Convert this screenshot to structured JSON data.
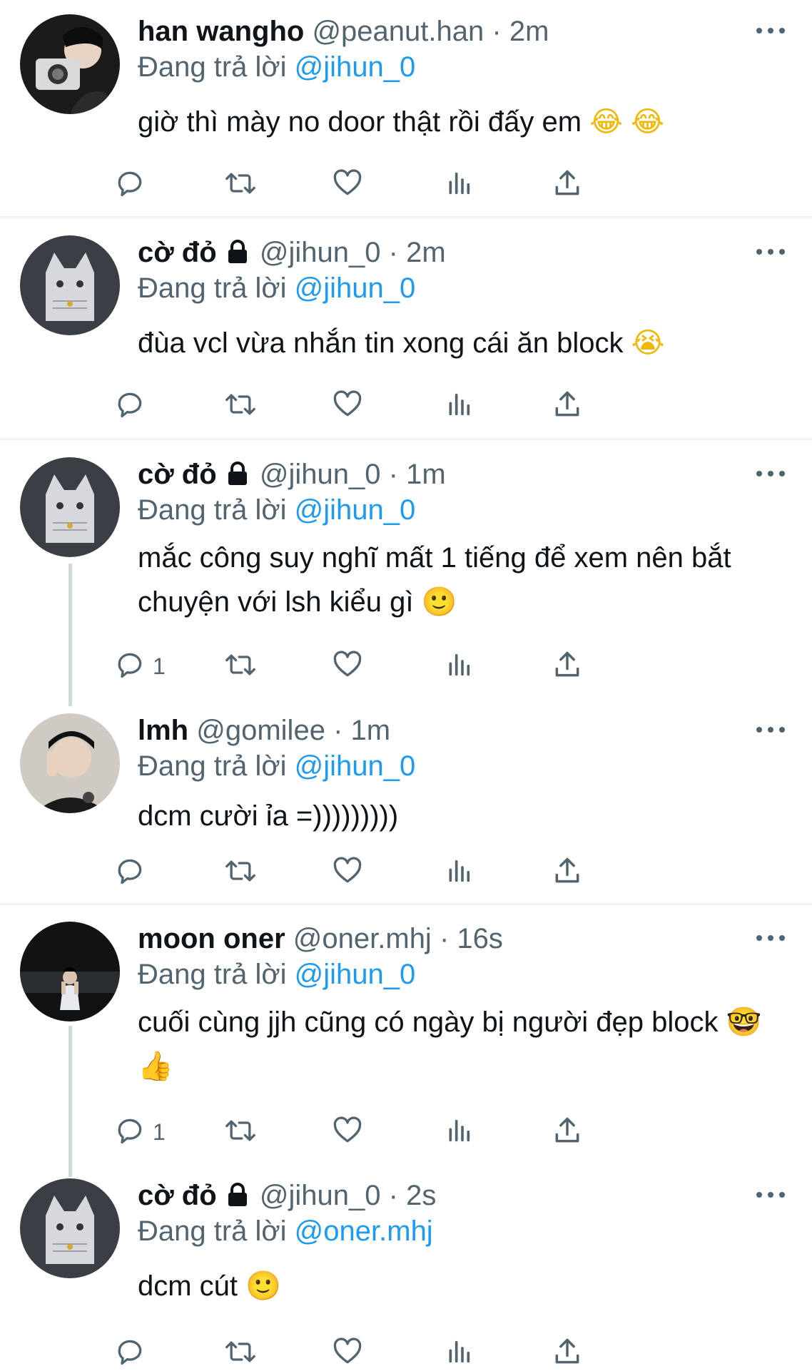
{
  "reply_prefix": "Đang trả lời",
  "accent_color": "#1d9bf0",
  "tweets": [
    {
      "name": "han wangho",
      "handle": "@peanut.han",
      "time": "2m",
      "locked": false,
      "reply_to": "@jihun_0",
      "text": "giờ thì mày no door thật rồi đấy em",
      "emoji": [
        "😂",
        "😂"
      ],
      "reply_count": ""
    },
    {
      "name": "cờ đỏ",
      "handle": "@jihun_0",
      "time": "2m",
      "locked": true,
      "reply_to": "@jihun_0",
      "text": "đùa vcl vừa nhắn tin xong cái ăn block",
      "emoji": [
        "😭"
      ],
      "reply_count": ""
    },
    {
      "name": "cờ đỏ",
      "handle": "@jihun_0",
      "time": "1m",
      "locked": true,
      "reply_to": "@jihun_0",
      "text": "mắc công suy nghĩ mất 1 tiếng để xem nên bắt chuyện với lsh kiểu gì",
      "emoji": [
        "🙂"
      ],
      "reply_count": "1"
    },
    {
      "name": "lmh",
      "handle": "@gomilee",
      "time": "1m",
      "locked": false,
      "reply_to": "@jihun_0",
      "text": "dcm cười ỉa =)))))))))",
      "emoji": [],
      "reply_count": ""
    },
    {
      "name": "moon oner",
      "handle": "@oner.mhj",
      "time": "16s",
      "locked": false,
      "reply_to": "@jihun_0",
      "text": "cuối cùng jjh cũng có ngày bị người đẹp block",
      "emoji": [
        "🤓",
        "👍"
      ],
      "reply_count": "1"
    },
    {
      "name": "cờ đỏ",
      "handle": "@jihun_0",
      "time": "2s",
      "locked": true,
      "reply_to": "@oner.mhj",
      "text": "dcm cút",
      "emoji": [
        "🙂"
      ],
      "reply_count": ""
    }
  ],
  "icons": {
    "reply": "reply-icon",
    "retweet": "retweet-icon",
    "like": "like-icon",
    "views": "views-icon",
    "share": "share-icon",
    "more": "more-icon",
    "lock": "lock-icon"
  }
}
